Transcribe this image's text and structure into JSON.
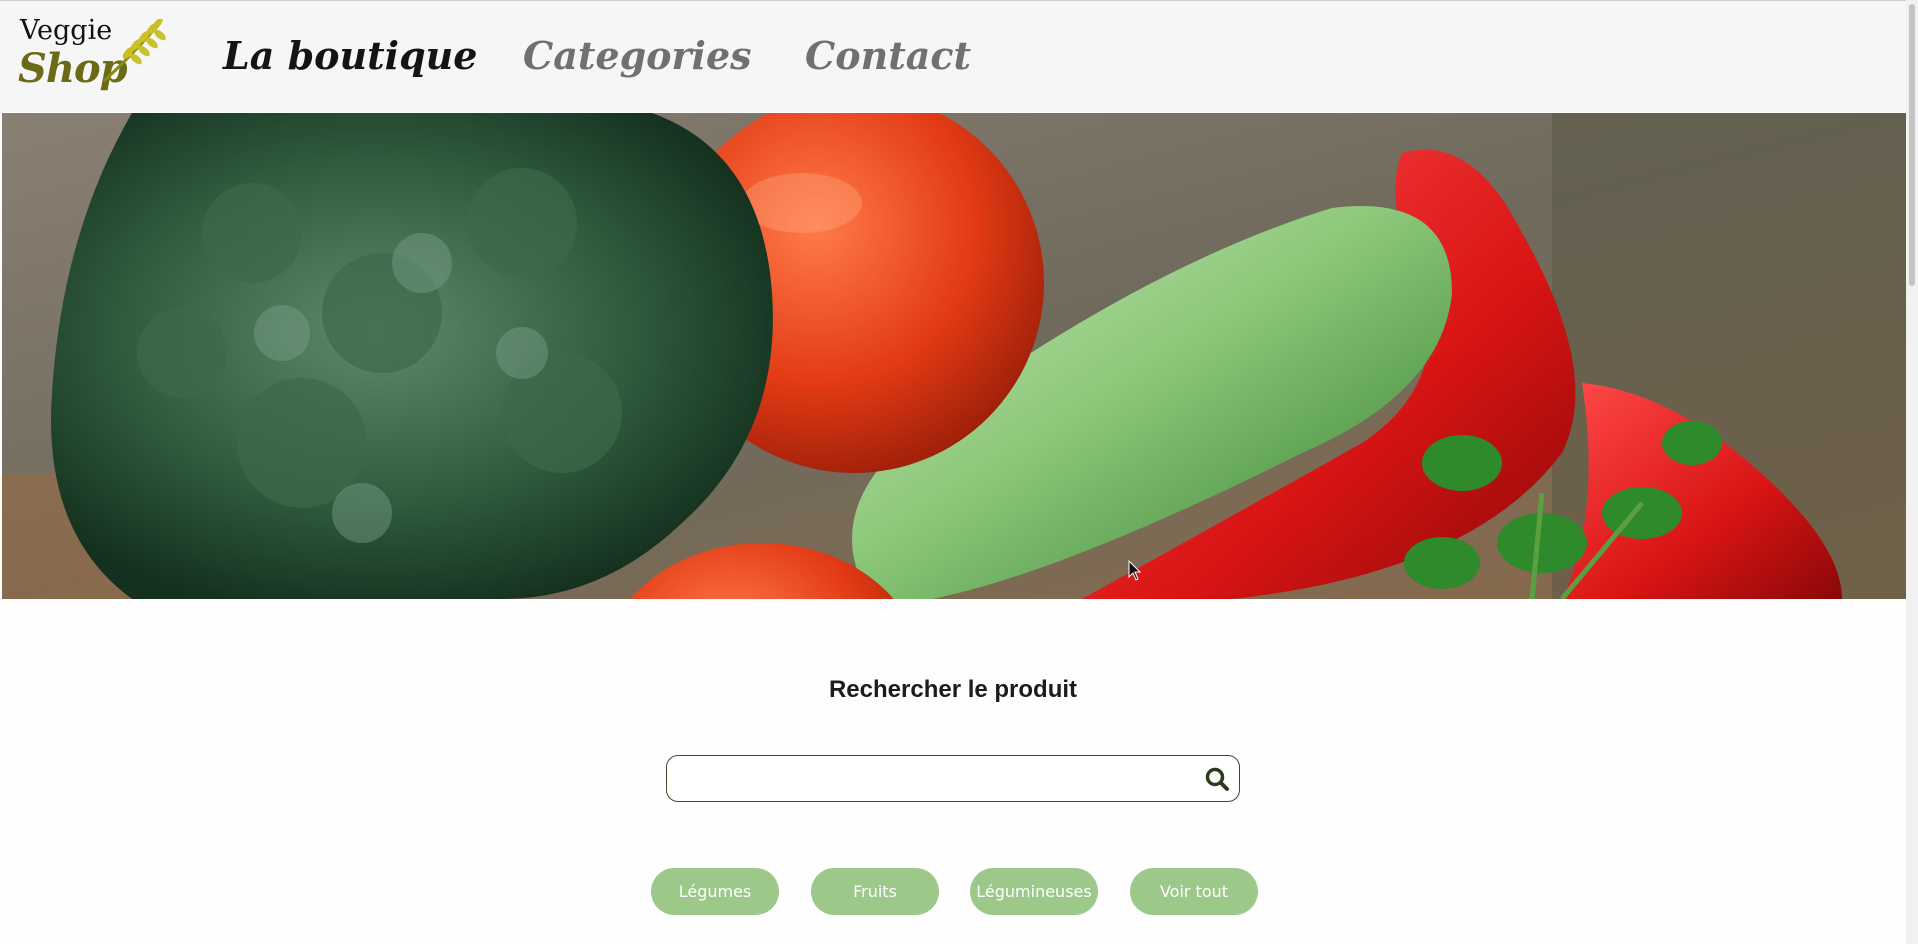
{
  "logo": {
    "line1": "Veggie",
    "line2": "Shop",
    "icon": "wheat-icon"
  },
  "nav": {
    "items": [
      {
        "label": "La boutique",
        "active": true
      },
      {
        "label": "Categories",
        "active": false
      },
      {
        "label": "Contact",
        "active": false
      }
    ]
  },
  "hero": {
    "image": "vegetables-banner"
  },
  "search": {
    "title": "Rechercher le produit",
    "value": "",
    "placeholder": "",
    "icon": "search-icon"
  },
  "categories": [
    {
      "label": "Légumes"
    },
    {
      "label": "Fruits"
    },
    {
      "label": "Légumineuses"
    },
    {
      "label": "Voir tout"
    }
  ],
  "colors": {
    "brand_olive": "#6b6a16",
    "pill_green": "#9cc98a",
    "search_border": "#3f4a2b"
  }
}
